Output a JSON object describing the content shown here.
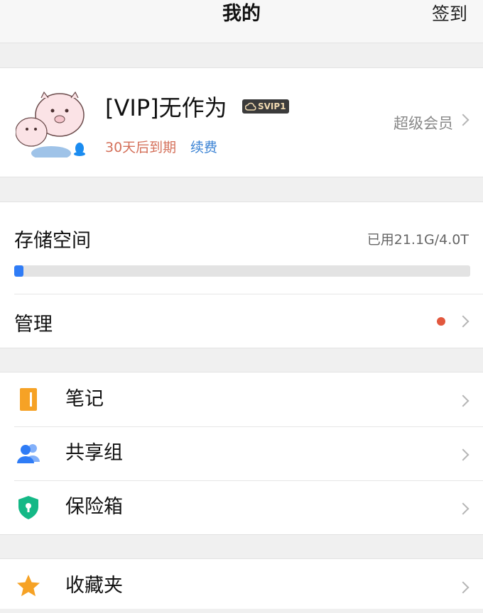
{
  "header": {
    "title": "我的",
    "sign_in": "签到"
  },
  "profile": {
    "username": "[VIP]无作为",
    "vip_badge": "SVIP1",
    "expiry": "30天后到期",
    "renew": "续费",
    "member_link": "超级会员",
    "colors": {
      "expiry": "#d4705a",
      "renew": "#3b83d4"
    }
  },
  "storage": {
    "label": "存储空间",
    "usage": "已用21.1G/4.0T",
    "used_fraction": 0.005,
    "manage_label": "管理"
  },
  "menu": [
    {
      "label": "笔记",
      "icon": "notebook-icon",
      "color": "#f6a225"
    },
    {
      "label": "共享组",
      "icon": "people-icon",
      "color": "#2f7cf6"
    },
    {
      "label": "保险箱",
      "icon": "shield-lock-icon",
      "color": "#14b886"
    }
  ],
  "menu2": [
    {
      "label": "收藏夹",
      "icon": "star-icon",
      "color": "#f6a225"
    }
  ]
}
